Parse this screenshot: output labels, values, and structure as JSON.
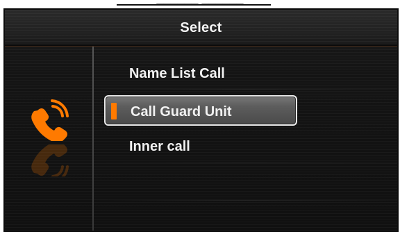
{
  "caption": {
    "text": "______ ______"
  },
  "header": {
    "title": "Select"
  },
  "sidebar": {
    "icon": "phone-ringing-icon"
  },
  "menu": {
    "items": [
      {
        "label": "Name List Call",
        "selected": false
      },
      {
        "label": "Call Guard Unit",
        "selected": true
      },
      {
        "label": "Inner call",
        "selected": false
      }
    ]
  },
  "colors": {
    "accent": "#ff7a00",
    "text": "#f1f1f1",
    "background": "#141414",
    "selected_border": "#e9e9e9",
    "selected_fill": "#5d5d5d"
  }
}
